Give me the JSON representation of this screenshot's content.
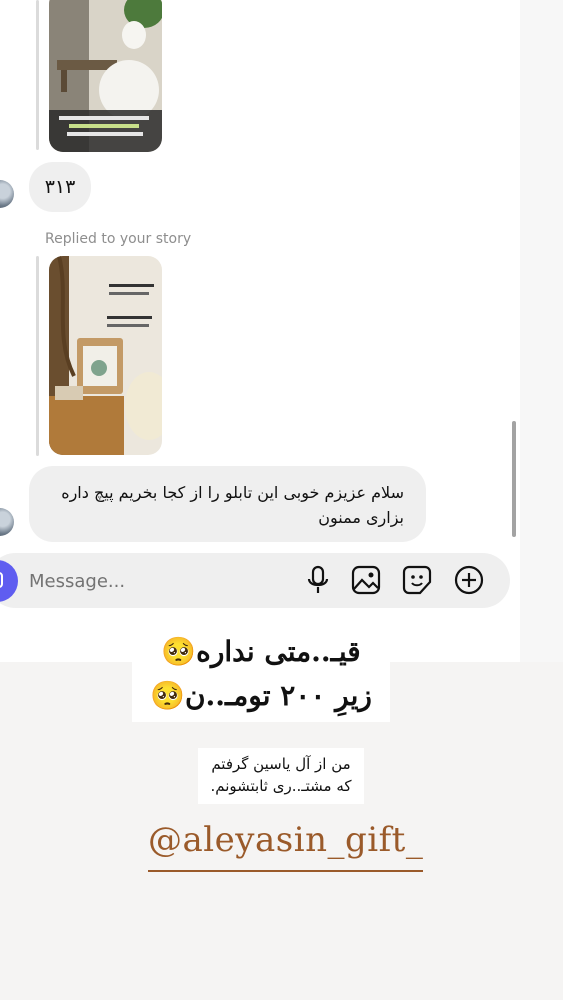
{
  "thread": {
    "message_number": "۳۱۳",
    "replied_label": "Replied to your story",
    "received_message": "سلام عزیزم خوبی این تابلو را از کجا بخریم پیچ داره بزاری ممنون"
  },
  "composer": {
    "placeholder": "Message...",
    "icons": [
      "camera-icon",
      "microphone-icon",
      "gallery-icon",
      "sticker-icon",
      "add-icon"
    ]
  },
  "story_overlay": {
    "price_line_1": "قیـ..متی نداره🥺",
    "price_line_2": "زیرِ ۲۰۰ تومـ..ن🥺",
    "note_line_1": "من از آل یاسین گرفتم",
    "note_line_2": "که مشتـ..ری ثابتشونم.",
    "handle": "@aleyasin_gift_"
  },
  "colors": {
    "accent": "#5f5df0",
    "bubble": "#efefef",
    "handle": "#9a5a2a"
  }
}
